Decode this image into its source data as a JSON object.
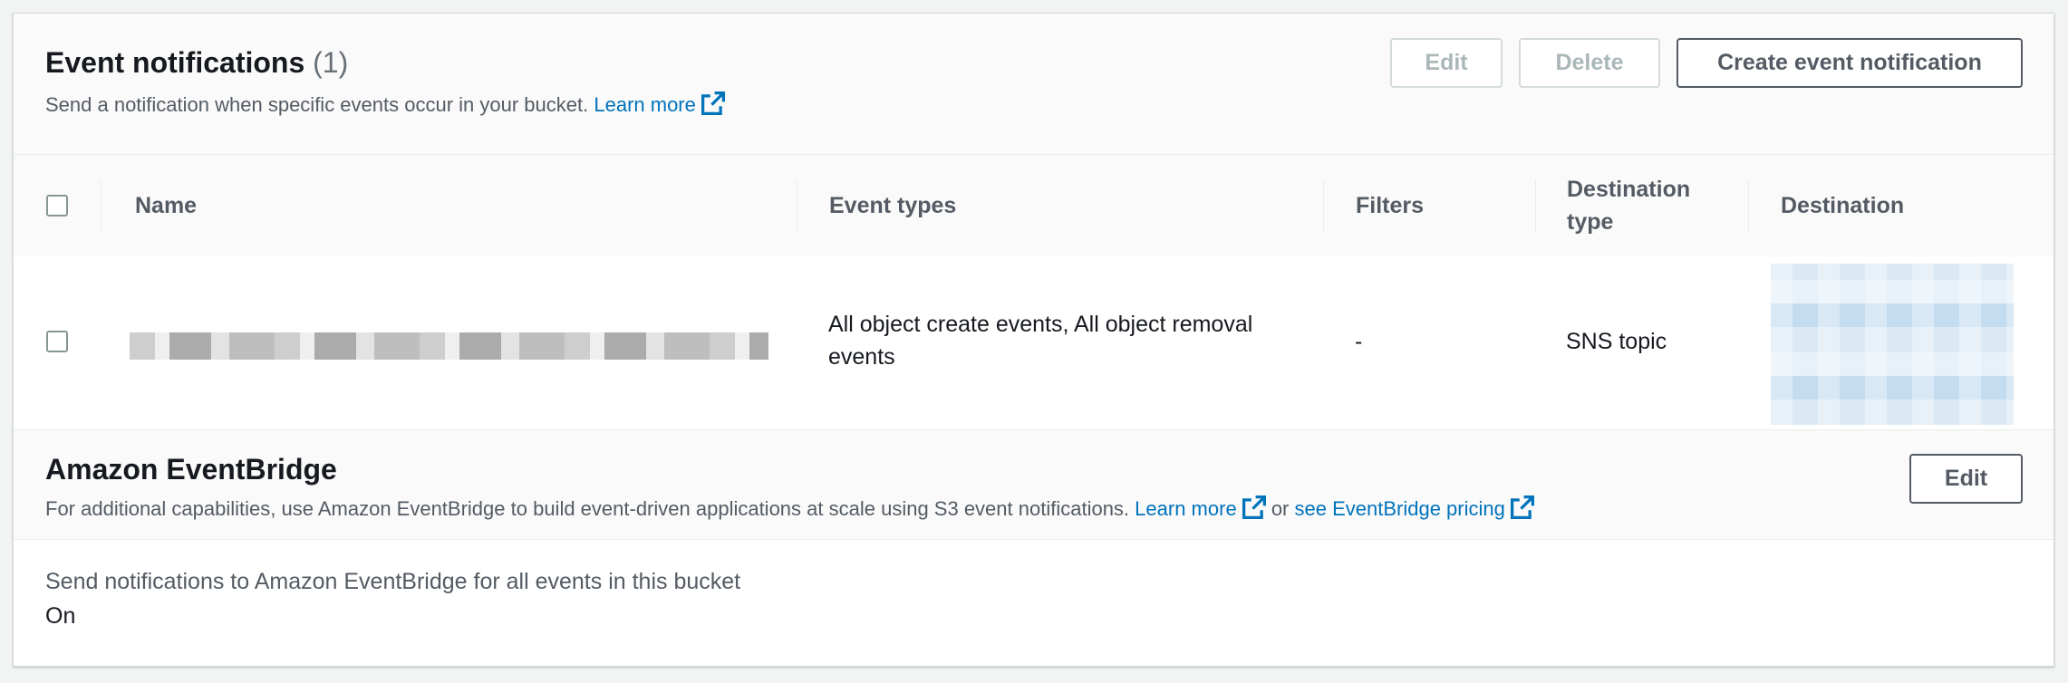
{
  "event_notifications": {
    "title": "Event notifications",
    "count": "(1)",
    "description": "Send a notification when specific events occur in your bucket.",
    "learn_more": "Learn more",
    "buttons": {
      "edit": "Edit",
      "delete": "Delete",
      "create": "Create event notification"
    },
    "table": {
      "columns": [
        "Name",
        "Event types",
        "Filters",
        "Destination type",
        "Destination"
      ],
      "rows": [
        {
          "name": "",
          "event_types": "All object create events, All object removal events",
          "filters": "-",
          "destination_type": "SNS topic",
          "destination": ""
        }
      ]
    }
  },
  "eventbridge": {
    "title": "Amazon EventBridge",
    "description": "For additional capabilities, use Amazon EventBridge to build event-driven applications at scale using S3 event notifications.",
    "learn_more": "Learn more",
    "or_text": "or",
    "pricing_link": "see EventBridge pricing",
    "edit_button": "Edit",
    "setting_label": "Send notifications to Amazon EventBridge for all events in this bucket",
    "setting_value": "On"
  },
  "colors": {
    "link": "#0073bb",
    "text": "#16191f",
    "muted": "#545b64",
    "disabled": "#aab7b8"
  },
  "icons": {
    "external_link": "external-link-icon",
    "checkbox": "checkbox"
  }
}
